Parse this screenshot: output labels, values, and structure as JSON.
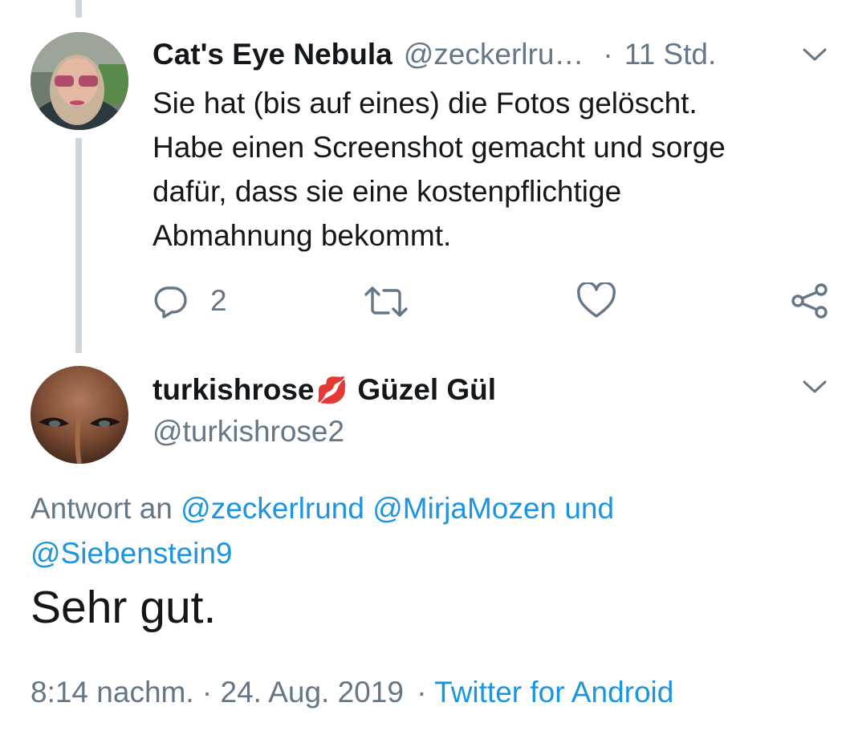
{
  "tweet1": {
    "display_name": "Cat's Eye Nebula",
    "handle": "@zeckerlru…",
    "separator": "·",
    "time_ago": "11 Std.",
    "text_lines": [
      "Sie hat (bis auf eines) die Fotos gelöscht.",
      "Habe einen Screenshot gemacht und sorge",
      "dafür, dass sie eine kostenpflichtige",
      "Abmahnung bekommt."
    ],
    "reply_count": "2"
  },
  "tweet2": {
    "display_name_1": "turkishrose",
    "emoji": "💋",
    "display_name_2": "Güzel Gül",
    "handle": "@turkishrose2",
    "reply_prefix": "Antwort an",
    "reply_to_1": "@zeckerlrund",
    "reply_to_2": "@MirjaMozen",
    "reply_and": "und",
    "reply_to_3": "@Siebenstein9",
    "text": "Sehr gut.",
    "time": "8:14 nachm.",
    "date_sep": "·",
    "date": "24. Aug. 2019",
    "source_sep": "·",
    "source": "Twitter for Android"
  },
  "colors": {
    "text": "#14171a",
    "muted": "#657786",
    "link": "#1b95e0",
    "thread_line": "#cdd5dd"
  },
  "icons": [
    "chevron-down-icon",
    "reply-icon",
    "retweet-icon",
    "like-icon",
    "share-icon"
  ]
}
